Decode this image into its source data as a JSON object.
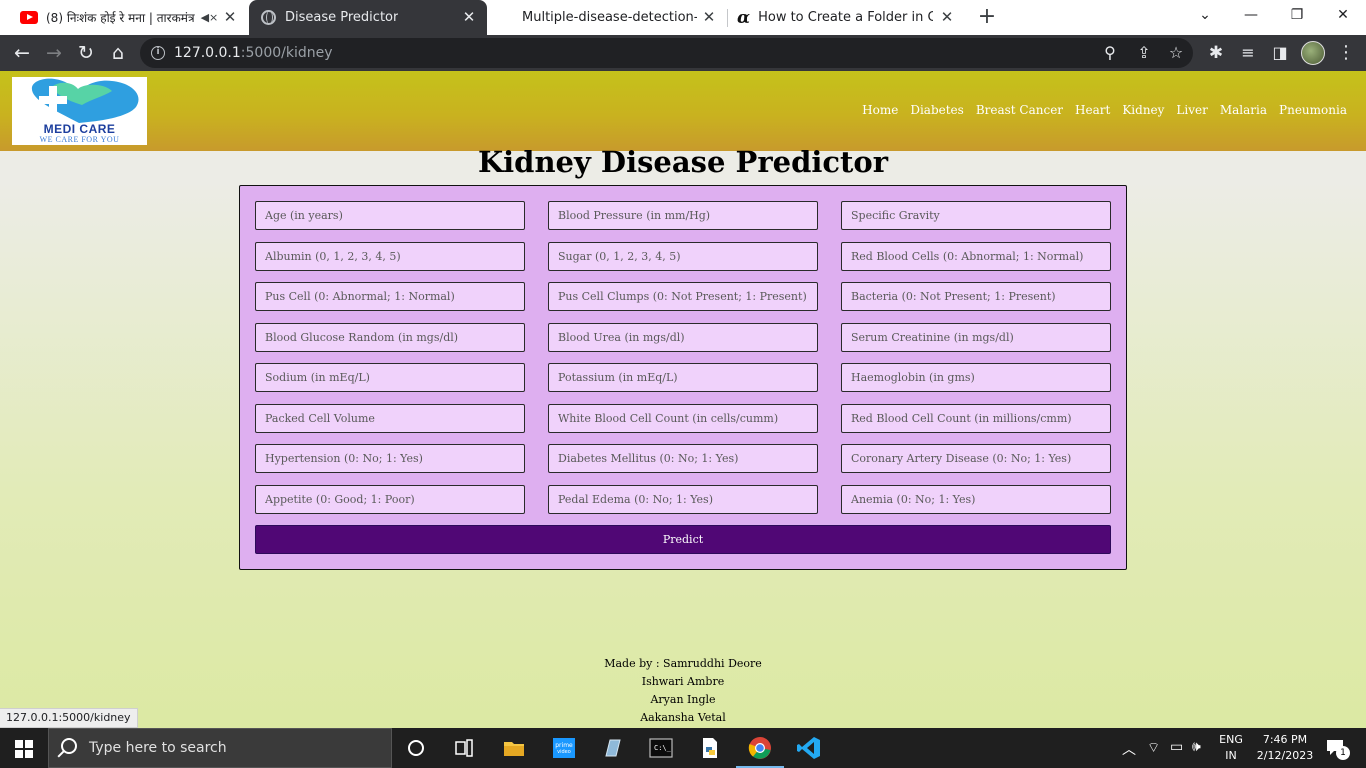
{
  "browser": {
    "tabs": [
      {
        "title": "(8) निःशंक होई रे मना | तारकमंत्र",
        "icon": "youtube-icon",
        "muted": true
      },
      {
        "title": "Disease Predictor",
        "icon": "globe-icon",
        "active": true
      },
      {
        "title": "Multiple-disease-detection-and-",
        "icon": "none"
      },
      {
        "title": "How to Create a Folder in Github",
        "icon": "alpha-icon"
      }
    ],
    "url_host": "127.0.0.1",
    "url_path": ":5000/kidney",
    "status_url": "127.0.0.1:5000/kidney"
  },
  "site": {
    "logo_text": "MEDI CARE",
    "logo_tagline": "WE CARE FOR YOU",
    "nav": [
      "Home",
      "Diabetes",
      "Breast Cancer",
      "Heart",
      "Kidney",
      "Liver",
      "Malaria",
      "Pneumonia"
    ],
    "page_title": "Kidney Disease Predictor",
    "fields": [
      "Age (in years)",
      "Blood Pressure (in mm/Hg)",
      "Specific Gravity",
      "Albumin (0, 1, 2, 3, 4, 5)",
      "Sugar (0, 1, 2, 3, 4, 5)",
      "Red Blood Cells (0: Abnormal; 1: Normal)",
      "Pus Cell (0: Abnormal; 1: Normal)",
      "Pus Cell Clumps (0: Not Present; 1: Present)",
      "Bacteria (0: Not Present; 1: Present)",
      "Blood Glucose Random (in mgs/dl)",
      "Blood Urea (in mgs/dl)",
      "Serum Creatinine (in mgs/dl)",
      "Sodium (in mEq/L)",
      "Potassium (in mEq/L)",
      "Haemoglobin (in gms)",
      "Packed Cell Volume",
      "White Blood Cell Count (in cells/cumm)",
      "Red Blood Cell Count (in millions/cmm)",
      "Hypertension (0: No; 1: Yes)",
      "Diabetes Mellitus (0: No; 1: Yes)",
      "Coronary Artery Disease (0: No; 1: Yes)",
      "Appetite (0: Good; 1: Poor)",
      "Pedal Edema (0: No; 1: Yes)",
      "Anemia (0: No; 1: Yes)"
    ],
    "predict_label": "Predict",
    "footer": [
      "Made by : Samruddhi Deore",
      "Ishwari Ambre",
      "Aryan Ingle",
      "Aakansha Vetal"
    ]
  },
  "taskbar": {
    "search_placeholder": "Type here to search",
    "lang_top": "ENG",
    "lang_bottom": "IN",
    "time": "7:46 PM",
    "date": "2/12/2023",
    "notification_count": "1"
  },
  "colors": {
    "header_gold": "#c9b21f",
    "form_bg": "#deaff0",
    "field_bg": "#f0d2fb",
    "predict_bg": "#500775"
  }
}
